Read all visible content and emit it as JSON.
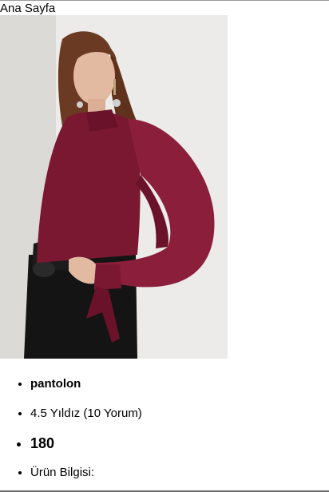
{
  "nav": {
    "home_link": "Ana Sayfa"
  },
  "product": {
    "image_icon": "product-photo",
    "name": "pantolon",
    "rating_text": "4.5 Yıldız (10 Yorum)",
    "price": "180",
    "details_label": "Ürün Bilgisi:"
  },
  "colors": {
    "blouse": "#7a1832",
    "background": "#e9e8e6",
    "pants": "#141414"
  }
}
